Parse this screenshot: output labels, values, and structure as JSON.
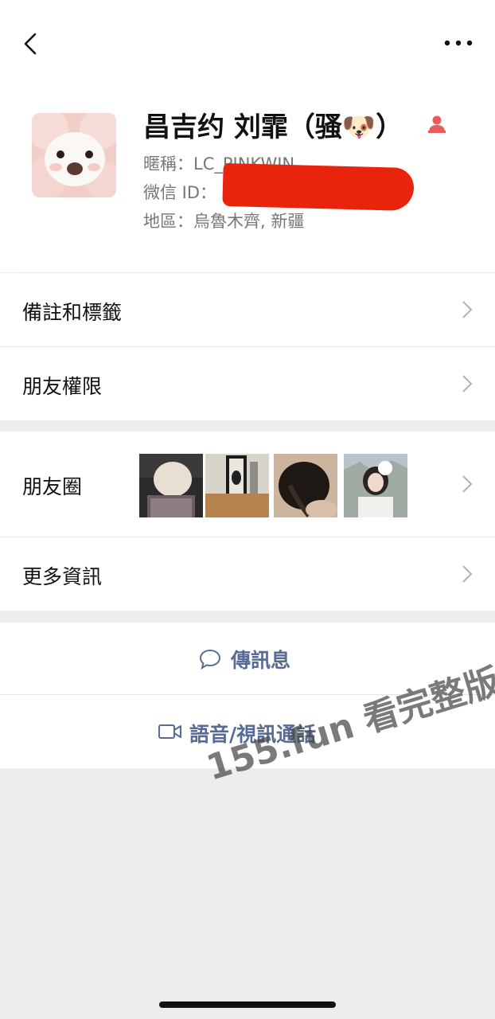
{
  "profile": {
    "name": "昌吉约 刘霏（骚🐶）",
    "nickname": "暱稱：LC_PINKWIN",
    "wechat_id_label": "微信 ID：",
    "region": "地區：烏魯木齊, 新疆"
  },
  "menu": {
    "remarks": "備註和標籤",
    "permissions": "朋友權限",
    "moments": "朋友圈",
    "more_info": "更多資訊"
  },
  "actions": {
    "message": "傳訊息",
    "call": "語音/視訊通話"
  },
  "watermark": "155.fun 看完整版",
  "colors": {
    "link": "#576b95",
    "redaction": "#e8240d",
    "verify": "#e85c5c"
  }
}
